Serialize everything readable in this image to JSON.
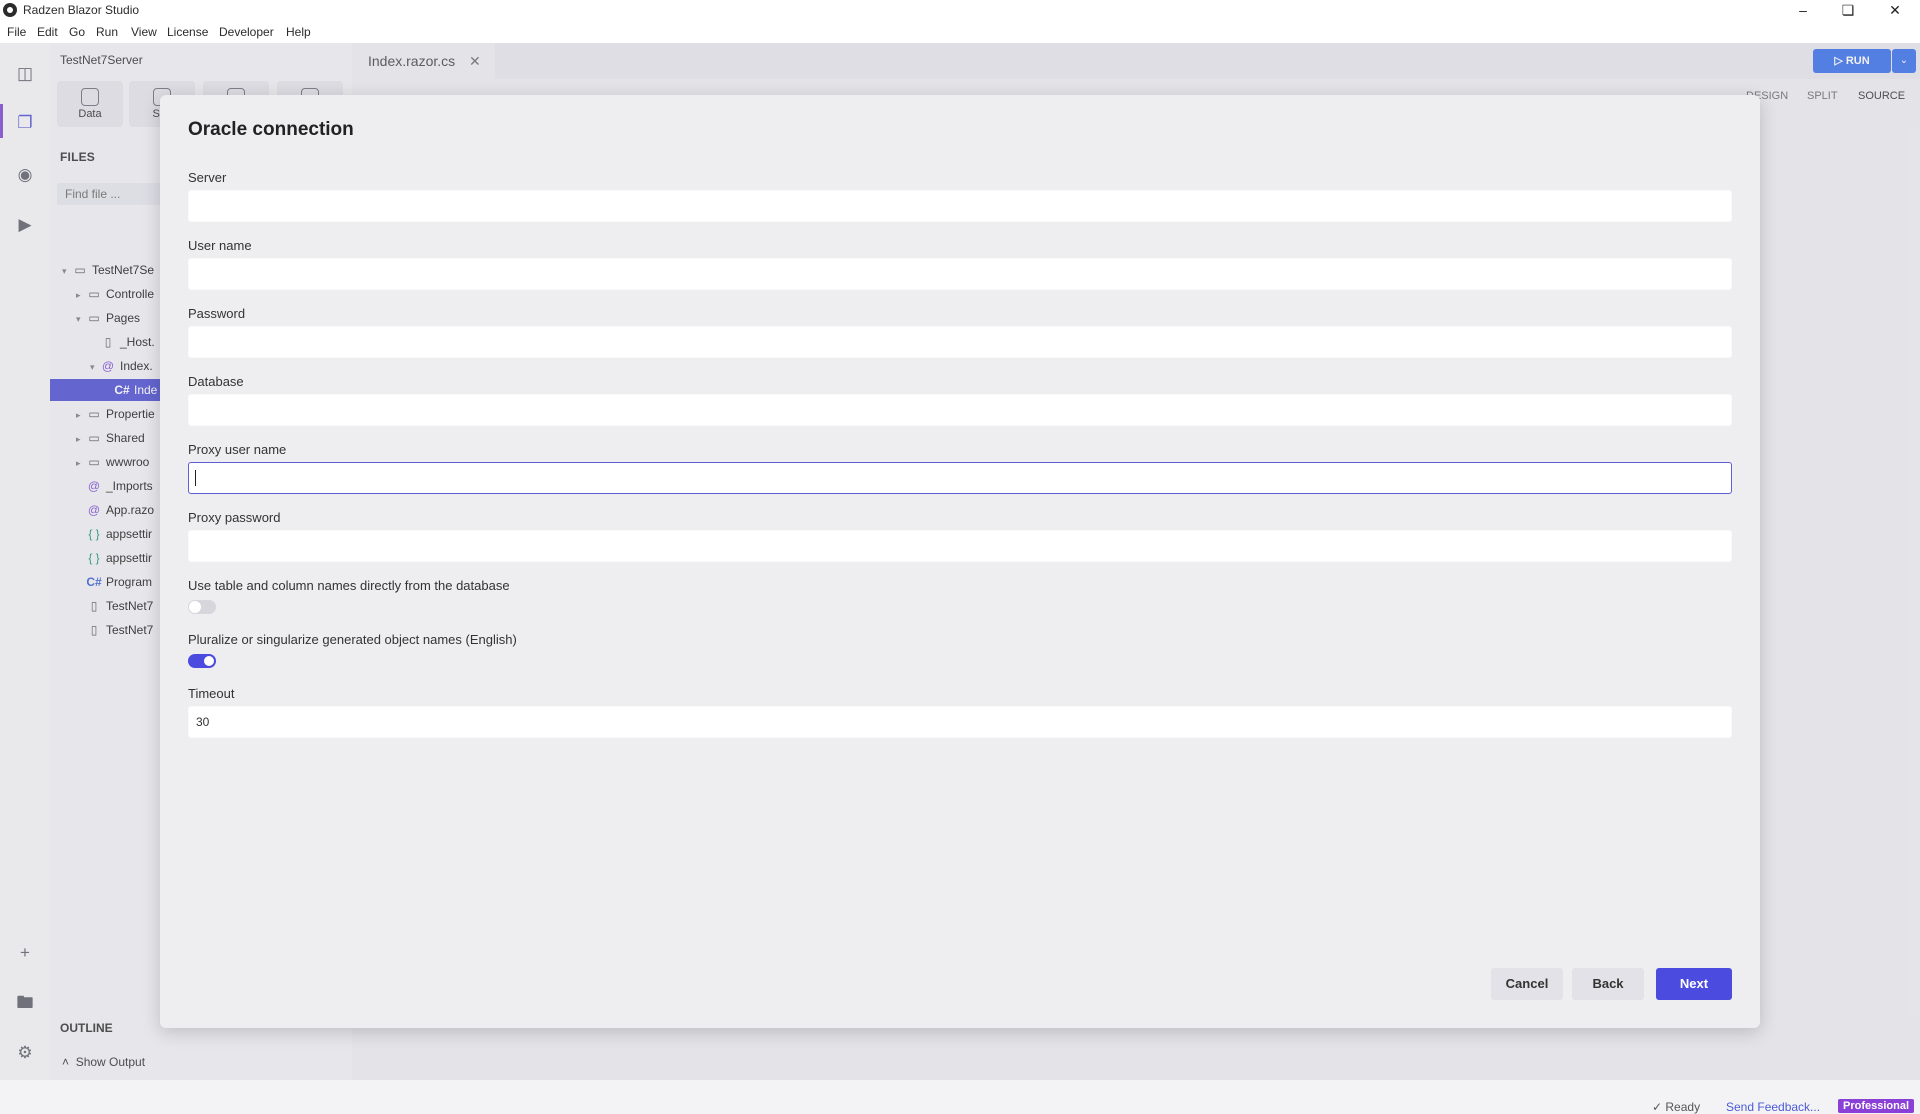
{
  "window": {
    "title": "Radzen Blazor Studio"
  },
  "menu": [
    "File",
    "Edit",
    "Go",
    "Run",
    "View",
    "License",
    "Developer",
    "Help"
  ],
  "sidebar": {
    "project": "TestNet7Server",
    "tools": [
      "Data",
      "Sec"
    ],
    "files_heading": "FILES",
    "find_placeholder": "Find file ...",
    "tree": [
      {
        "label": "TestNet7Se",
        "icon": "folder-icon",
        "chev": "▾",
        "level": 0
      },
      {
        "label": "Controlle",
        "icon": "folder-icon",
        "chev": "▸",
        "level": 1
      },
      {
        "label": "Pages",
        "icon": "folder-icon",
        "chev": "▾",
        "level": 1
      },
      {
        "label": "_Host.",
        "icon": "file-icon",
        "chev": "",
        "level": 2
      },
      {
        "label": "Index.",
        "icon": "razor-icon",
        "chev": "▾",
        "level": 2
      },
      {
        "label": "Inde",
        "icon": "csharp-icon",
        "chev": "",
        "level": 3,
        "selected": true
      },
      {
        "label": "Propertie",
        "icon": "folder-icon",
        "chev": "▸",
        "level": 1
      },
      {
        "label": "Shared",
        "icon": "folder-icon",
        "chev": "▸",
        "level": 1
      },
      {
        "label": "wwwroo",
        "icon": "folder-icon",
        "chev": "▸",
        "level": 1
      },
      {
        "label": "_Imports",
        "icon": "razor-icon",
        "chev": "",
        "level": 1
      },
      {
        "label": "App.razo",
        "icon": "razor-icon",
        "chev": "",
        "level": 1
      },
      {
        "label": "appsettir",
        "icon": "json-icon",
        "chev": "",
        "level": 1
      },
      {
        "label": "appsettir",
        "icon": "json-icon",
        "chev": "",
        "level": 1
      },
      {
        "label": "Program",
        "icon": "csharp-icon",
        "chev": "",
        "level": 1
      },
      {
        "label": "TestNet7",
        "icon": "file-icon",
        "chev": "",
        "level": 1
      },
      {
        "label": "TestNet7",
        "icon": "file-icon",
        "chev": "",
        "level": 1
      }
    ],
    "outline_heading": "OUTLINE",
    "show_output": "Show Output"
  },
  "editor": {
    "tab": "Index.razor.cs",
    "run_label": "RUN",
    "modes": [
      "DESIGN",
      "SPLIT",
      "SOURCE"
    ]
  },
  "status": {
    "ready": "Ready",
    "feedback": "Send Feedback...",
    "badge": "Professional"
  },
  "dialog": {
    "title": "Oracle connection",
    "fields": [
      {
        "label": "Server",
        "value": ""
      },
      {
        "label": "User name",
        "value": ""
      },
      {
        "label": "Password",
        "value": ""
      },
      {
        "label": "Database",
        "value": ""
      },
      {
        "label": "Proxy user name",
        "value": ""
      },
      {
        "label": "Proxy password",
        "value": ""
      }
    ],
    "toggles": [
      {
        "label": "Use table and column names directly from the database",
        "on": false
      },
      {
        "label": "Pluralize or singularize generated object names (English)",
        "on": true
      }
    ],
    "timeout": {
      "label": "Timeout",
      "value": "30"
    },
    "buttons": {
      "cancel": "Cancel",
      "back": "Back",
      "next": "Next"
    }
  },
  "colors": {
    "accent": "#4b4be0",
    "selection": "#5e5fd6",
    "run": "#4b7bec",
    "badge": "#8a3fd6"
  }
}
